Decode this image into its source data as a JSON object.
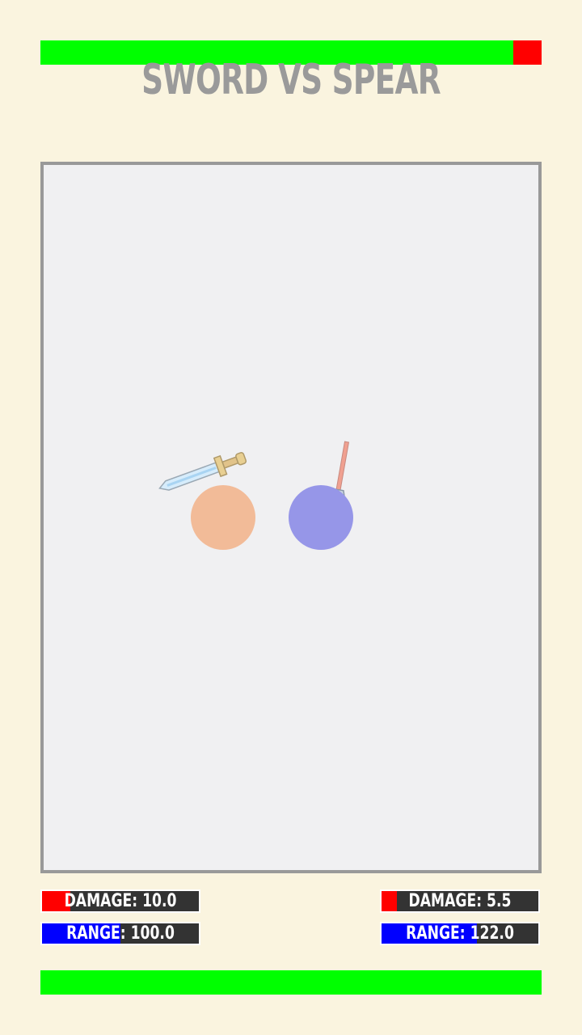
{
  "title": "SWORD VS SPEAR",
  "top_health": {
    "fraction": 0.944,
    "fill_color": "#00ff00",
    "empty_color": "#ff0000"
  },
  "bottom_health": {
    "fraction": 1.0,
    "fill_color": "#00ff00",
    "empty_color": "#ff0000"
  },
  "arena": {
    "background": "#f0f0f2",
    "border_color": "#999999"
  },
  "fighters": [
    {
      "name": "sword",
      "color": "#f2bb98",
      "weapon_icon": "sword-icon"
    },
    {
      "name": "spear",
      "color": "#9696e8",
      "weapon_icon": "spear-icon"
    }
  ],
  "left_stats": {
    "damage_text": "DAMAGE: 10.0",
    "damage_fraction": 0.18,
    "range_text": "RANGE: 100.0",
    "range_fraction": 0.5
  },
  "right_stats": {
    "damage_text": "DAMAGE: 5.5",
    "damage_fraction": 0.1,
    "range_text": "RANGE: 122.0",
    "range_fraction": 0.61
  },
  "colors": {
    "damage_bar": "#ff0000",
    "range_bar": "#0000ff",
    "stat_bg": "#333333"
  }
}
